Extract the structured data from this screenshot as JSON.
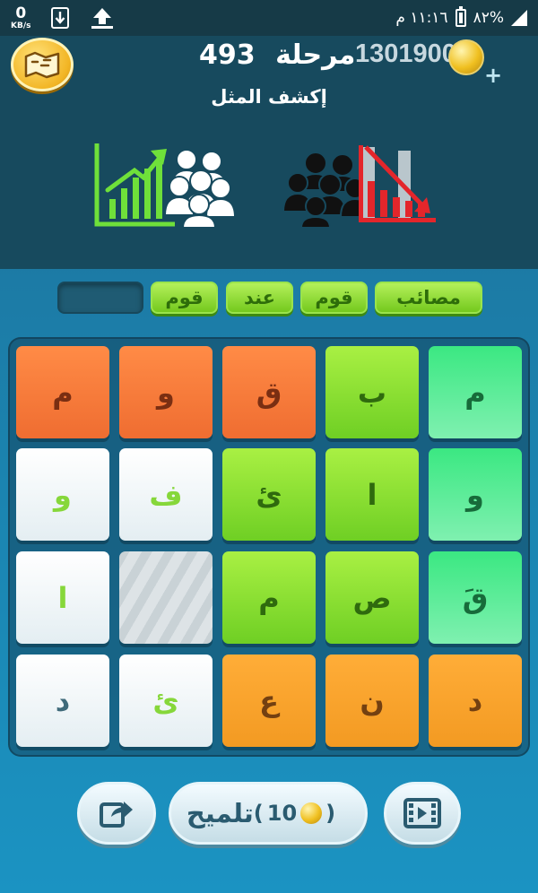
{
  "status_bar": {
    "net_speed": "0",
    "net_unit": "KB/s",
    "time": "١١:١٦ م",
    "battery": "%٨٢"
  },
  "header": {
    "level_label": "مرحلة",
    "level_number": "493",
    "coins": "1301900",
    "add_coins_symbol": "+"
  },
  "puzzle": {
    "prompt": "إكشف المثل",
    "left_picture": "growth-chart-crowd-icon",
    "right_picture": "decline-chart-crowd-icon"
  },
  "answer": {
    "slots": [
      "مصائب",
      "قوم",
      "عند",
      "قوم",
      ""
    ]
  },
  "grid": {
    "rows": [
      [
        "م",
        "و",
        "ق",
        "ب",
        "م"
      ],
      [
        "و",
        "ف",
        "ئ",
        "ا",
        "و"
      ],
      [
        "ا",
        "",
        "م",
        "ص",
        "قَ"
      ],
      [
        "د",
        "ئ",
        "ع",
        "ن",
        "د"
      ]
    ]
  },
  "buttons": {
    "hint_label": "تلميح",
    "hint_cost": "10",
    "share_icon": "share-icon",
    "video_icon": "video-icon"
  },
  "colors": {
    "orange": "#ef6d31",
    "lime": "#74c91e",
    "mint": "#3be882",
    "amber": "#f39a22",
    "panel": "#174a5e"
  }
}
